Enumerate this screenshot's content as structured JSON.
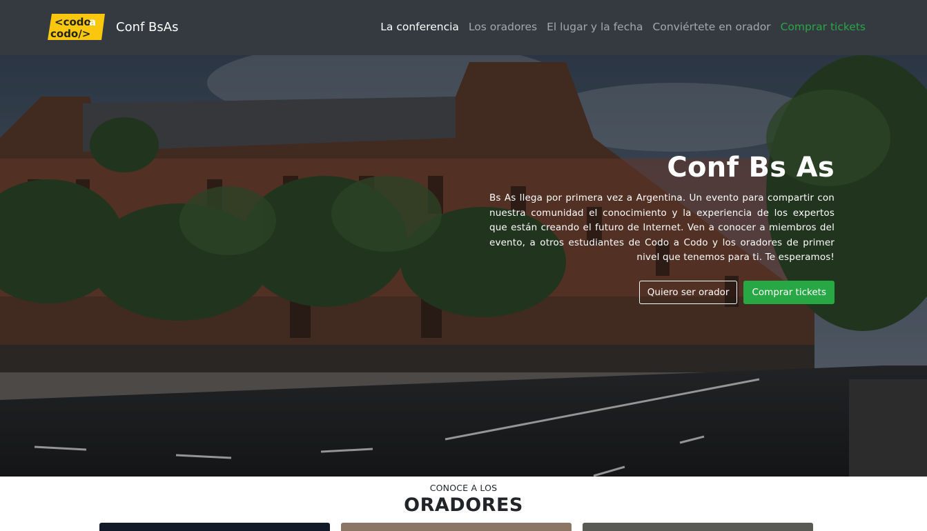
{
  "navbar": {
    "logo": {
      "line1": "<codo",
      "accent": "a",
      "line2": "codo/>",
      "bg_color": "#f9c80e"
    },
    "brand": "Conf BsAs",
    "links": [
      {
        "label": "La conferencia",
        "state": "active"
      },
      {
        "label": "Los oradores",
        "state": "normal"
      },
      {
        "label": "El lugar y la fecha",
        "state": "normal"
      },
      {
        "label": "Conviértete en orador",
        "state": "normal"
      },
      {
        "label": "Comprar tickets",
        "state": "highlight"
      }
    ],
    "colors": {
      "bg": "#343a40",
      "link": "#a3a8ad",
      "active": "#ffffff",
      "highlight": "#28a745"
    }
  },
  "hero": {
    "title": "Conf Bs As",
    "text": "Bs As llega por primera vez a Argentina. Un evento para compartir con nuestra comunidad el conocimiento y la experiencia de los expertos que están creando el futuro de Internet. Ven a conocer a miembros del evento, a otros estudiantes de Codo a Codo y los oradores de primer nivel que tenemos para ti. Te esperamos!",
    "buttons": {
      "speaker": "Quiero ser orador",
      "tickets": "Comprar tickets"
    },
    "image": "building-street-photo"
  },
  "speakers": {
    "kicker": "CONOCE A LOS",
    "title": "ORADORES"
  }
}
